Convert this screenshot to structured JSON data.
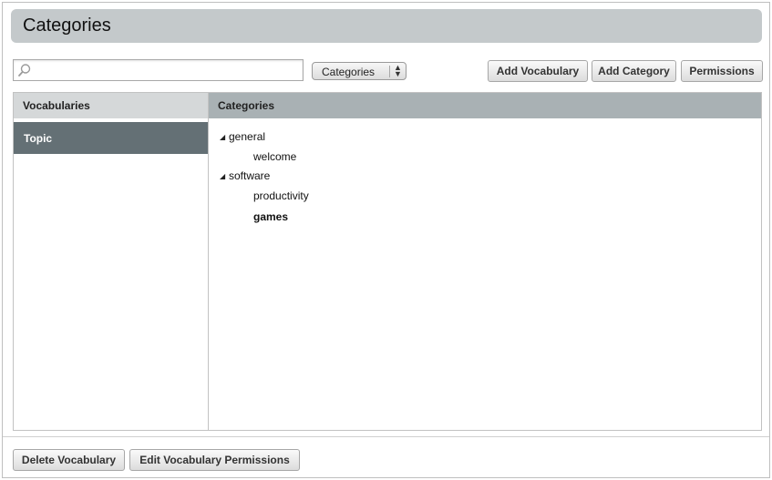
{
  "header": {
    "title": "Categories"
  },
  "toolbar": {
    "search": {
      "placeholder": "",
      "value": ""
    },
    "select": {
      "selected": "Categories"
    },
    "add_vocabulary": "Add Vocabulary",
    "add_category": "Add Category",
    "permissions": "Permissions"
  },
  "vocabularies": {
    "header": "Vocabularies",
    "items": [
      {
        "label": "Topic",
        "selected": true
      }
    ]
  },
  "categories": {
    "header": "Categories",
    "tree": [
      {
        "label": "general",
        "expanded": true,
        "children": [
          {
            "label": "welcome"
          }
        ]
      },
      {
        "label": "software",
        "expanded": true,
        "children": [
          {
            "label": "productivity"
          },
          {
            "label": "games",
            "selected": true
          }
        ]
      }
    ]
  },
  "footer": {
    "delete_vocabulary": "Delete Vocabulary",
    "edit_vocabulary_permissions": "Edit Vocabulary Permissions"
  },
  "icons": {
    "search": "search-icon",
    "expand": "triangle-expanded-icon",
    "select_arrows": "updown-arrows-icon"
  },
  "colors": {
    "title_bar": "#c4c9cb",
    "selected_vocab": "#647075",
    "categories_header": "#a9b1b4",
    "vocab_header": "#d5d8d9"
  }
}
